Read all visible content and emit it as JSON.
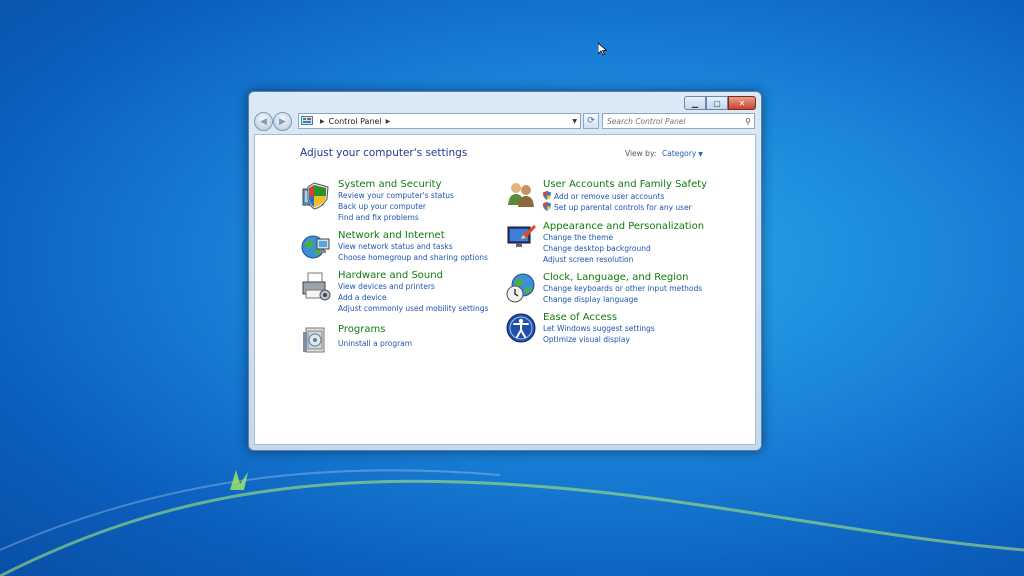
{
  "window": {
    "address_crumb": "Control Panel",
    "search_placeholder": "Search Control Panel"
  },
  "header": {
    "title": "Adjust your computer's settings",
    "view_by_label": "View by:",
    "view_by_value": "Category"
  },
  "categories": {
    "system_security": {
      "title": "System and Security",
      "links": [
        "Review your computer's status",
        "Back up your computer",
        "Find and fix problems"
      ]
    },
    "network_internet": {
      "title": "Network and Internet",
      "links": [
        "View network status and tasks",
        "Choose homegroup and sharing options"
      ]
    },
    "hardware_sound": {
      "title": "Hardware and Sound",
      "links": [
        "View devices and printers",
        "Add a device",
        "Adjust commonly used mobility settings"
      ]
    },
    "programs": {
      "title": "Programs",
      "links": [
        "Uninstall a program"
      ]
    },
    "user_accounts": {
      "title": "User Accounts and Family Safety",
      "links": [
        "Add or remove user accounts",
        "Set up parental controls for any user"
      ]
    },
    "appearance": {
      "title": "Appearance and Personalization",
      "links": [
        "Change the theme",
        "Change desktop background",
        "Adjust screen resolution"
      ]
    },
    "clock_language": {
      "title": "Clock, Language, and Region",
      "links": [
        "Change keyboards or other input methods",
        "Change display language"
      ]
    },
    "ease_access": {
      "title": "Ease of Access",
      "links": [
        "Let Windows suggest settings",
        "Optimize visual display"
      ]
    }
  },
  "colors": {
    "category_title": "#0f7a0c",
    "link": "#1f55b4",
    "heading": "#1e3b8f"
  }
}
